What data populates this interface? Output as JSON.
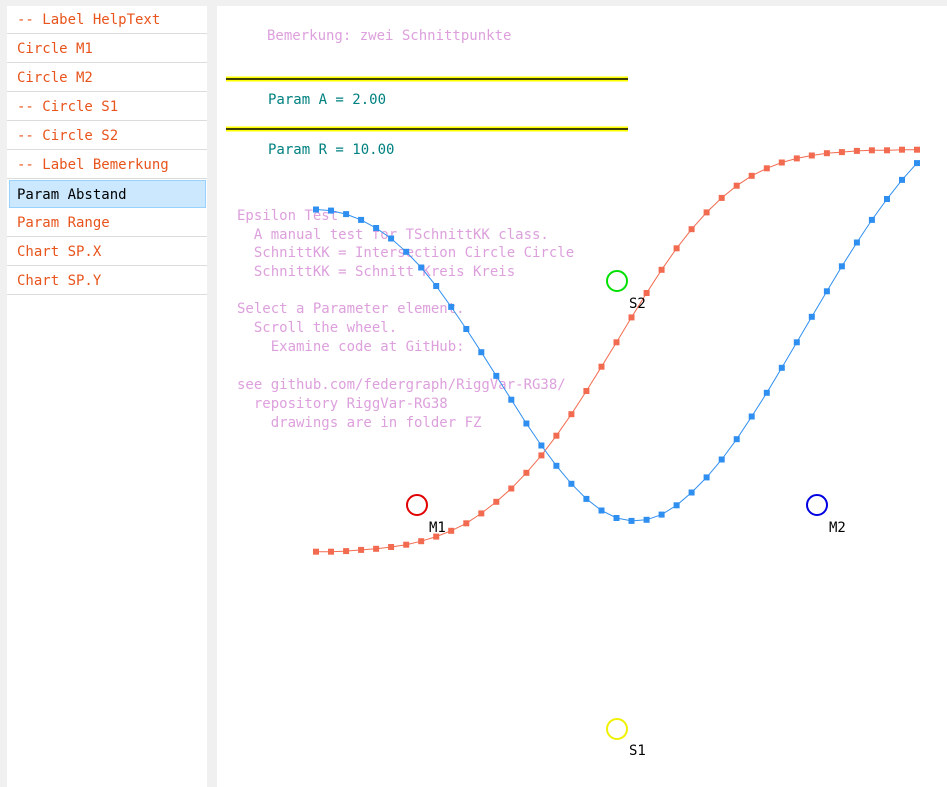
{
  "sidebar": {
    "items": [
      {
        "label": "-- Label HelpText",
        "color": "#e8541c",
        "selected": false
      },
      {
        "label": "Circle M1",
        "color": "#e8541c",
        "selected": false
      },
      {
        "label": "Circle M2",
        "color": "#e8541c",
        "selected": false
      },
      {
        "label": "-- Circle S1",
        "color": "#e8541c",
        "selected": false
      },
      {
        "label": "-- Circle S2",
        "color": "#e8541c",
        "selected": false
      },
      {
        "label": "-- Label Bemerkung",
        "color": "#e8541c",
        "selected": false
      },
      {
        "label": "Param Abstand",
        "color": "#000000",
        "selected": true
      },
      {
        "label": "Param Range",
        "color": "#e8541c",
        "selected": false
      },
      {
        "label": "Chart SP.X",
        "color": "#e8541c",
        "selected": false
      },
      {
        "label": "Chart SP.Y",
        "color": "#e8541c",
        "selected": false
      }
    ]
  },
  "canvas": {
    "remark": "Bemerkung: zwei Schnittpunkte",
    "params": [
      {
        "text": "Param A = 2.00"
      },
      {
        "text": "Param R = 10.00"
      }
    ],
    "help_lines": [
      "Epsilon Test",
      "  A manual test for TSchnittKK class.",
      "  SchnittKK = Intersection Circle Circle",
      "  SchnittKK = Schnitt Kreis Kreis",
      "",
      "Select a Parameter element.",
      "  Scroll the wheel.",
      "    Examine code at GitHub:",
      "",
      "see github.com/federgraph/RiggVar-RG38/",
      "  repository RiggVar-RG38",
      "    drawings are in folder FZ"
    ],
    "circles": [
      {
        "name": "M1",
        "label": "M1",
        "color": "#e00000"
      },
      {
        "name": "M2",
        "label": "M2",
        "color": "#0000e0"
      },
      {
        "name": "S1",
        "label": "S1",
        "color": "#f0f000"
      },
      {
        "name": "S2",
        "label": "S2",
        "color": "#00e000"
      }
    ]
  },
  "colors": {
    "text_orange": "#e8541c",
    "param_teal": "#008080",
    "help_violet": "#dda0dd",
    "param_line_yellow": "#ffff00",
    "chart_red": "#f26b50",
    "chart_blue": "#2f8ff0"
  },
  "chart_data": {
    "type": "line",
    "title": "",
    "xlabel": "",
    "ylabel": "",
    "series": [
      {
        "color": "#f26b50",
        "values": [
          -2.96,
          -2.96,
          -2.95,
          -2.93,
          -2.91,
          -2.88,
          -2.84,
          -2.78,
          -2.7,
          -2.6,
          -2.47,
          -2.3,
          -2.1,
          -1.87,
          -1.6,
          -1.3,
          -0.96,
          -0.59,
          -0.19,
          0.23,
          0.65,
          1.08,
          1.5,
          1.9,
          2.27,
          2.6,
          2.89,
          3.14,
          3.35,
          3.52,
          3.65,
          3.75,
          3.82,
          3.87,
          3.91,
          3.93,
          3.95,
          3.96,
          3.96,
          3.97,
          3.97
        ]
      },
      {
        "color": "#2f8ff0",
        "values": [
          2.94,
          2.92,
          2.86,
          2.76,
          2.62,
          2.44,
          2.21,
          1.94,
          1.62,
          1.26,
          0.88,
          0.48,
          0.07,
          -0.34,
          -0.75,
          -1.13,
          -1.48,
          -1.79,
          -2.05,
          -2.25,
          -2.38,
          -2.43,
          -2.41,
          -2.32,
          -2.16,
          -1.94,
          -1.68,
          -1.37,
          -1.02,
          -0.63,
          -0.22,
          0.21,
          0.65,
          1.09,
          1.53,
          1.96,
          2.37,
          2.76,
          3.12,
          3.45,
          3.74
        ]
      }
    ]
  }
}
